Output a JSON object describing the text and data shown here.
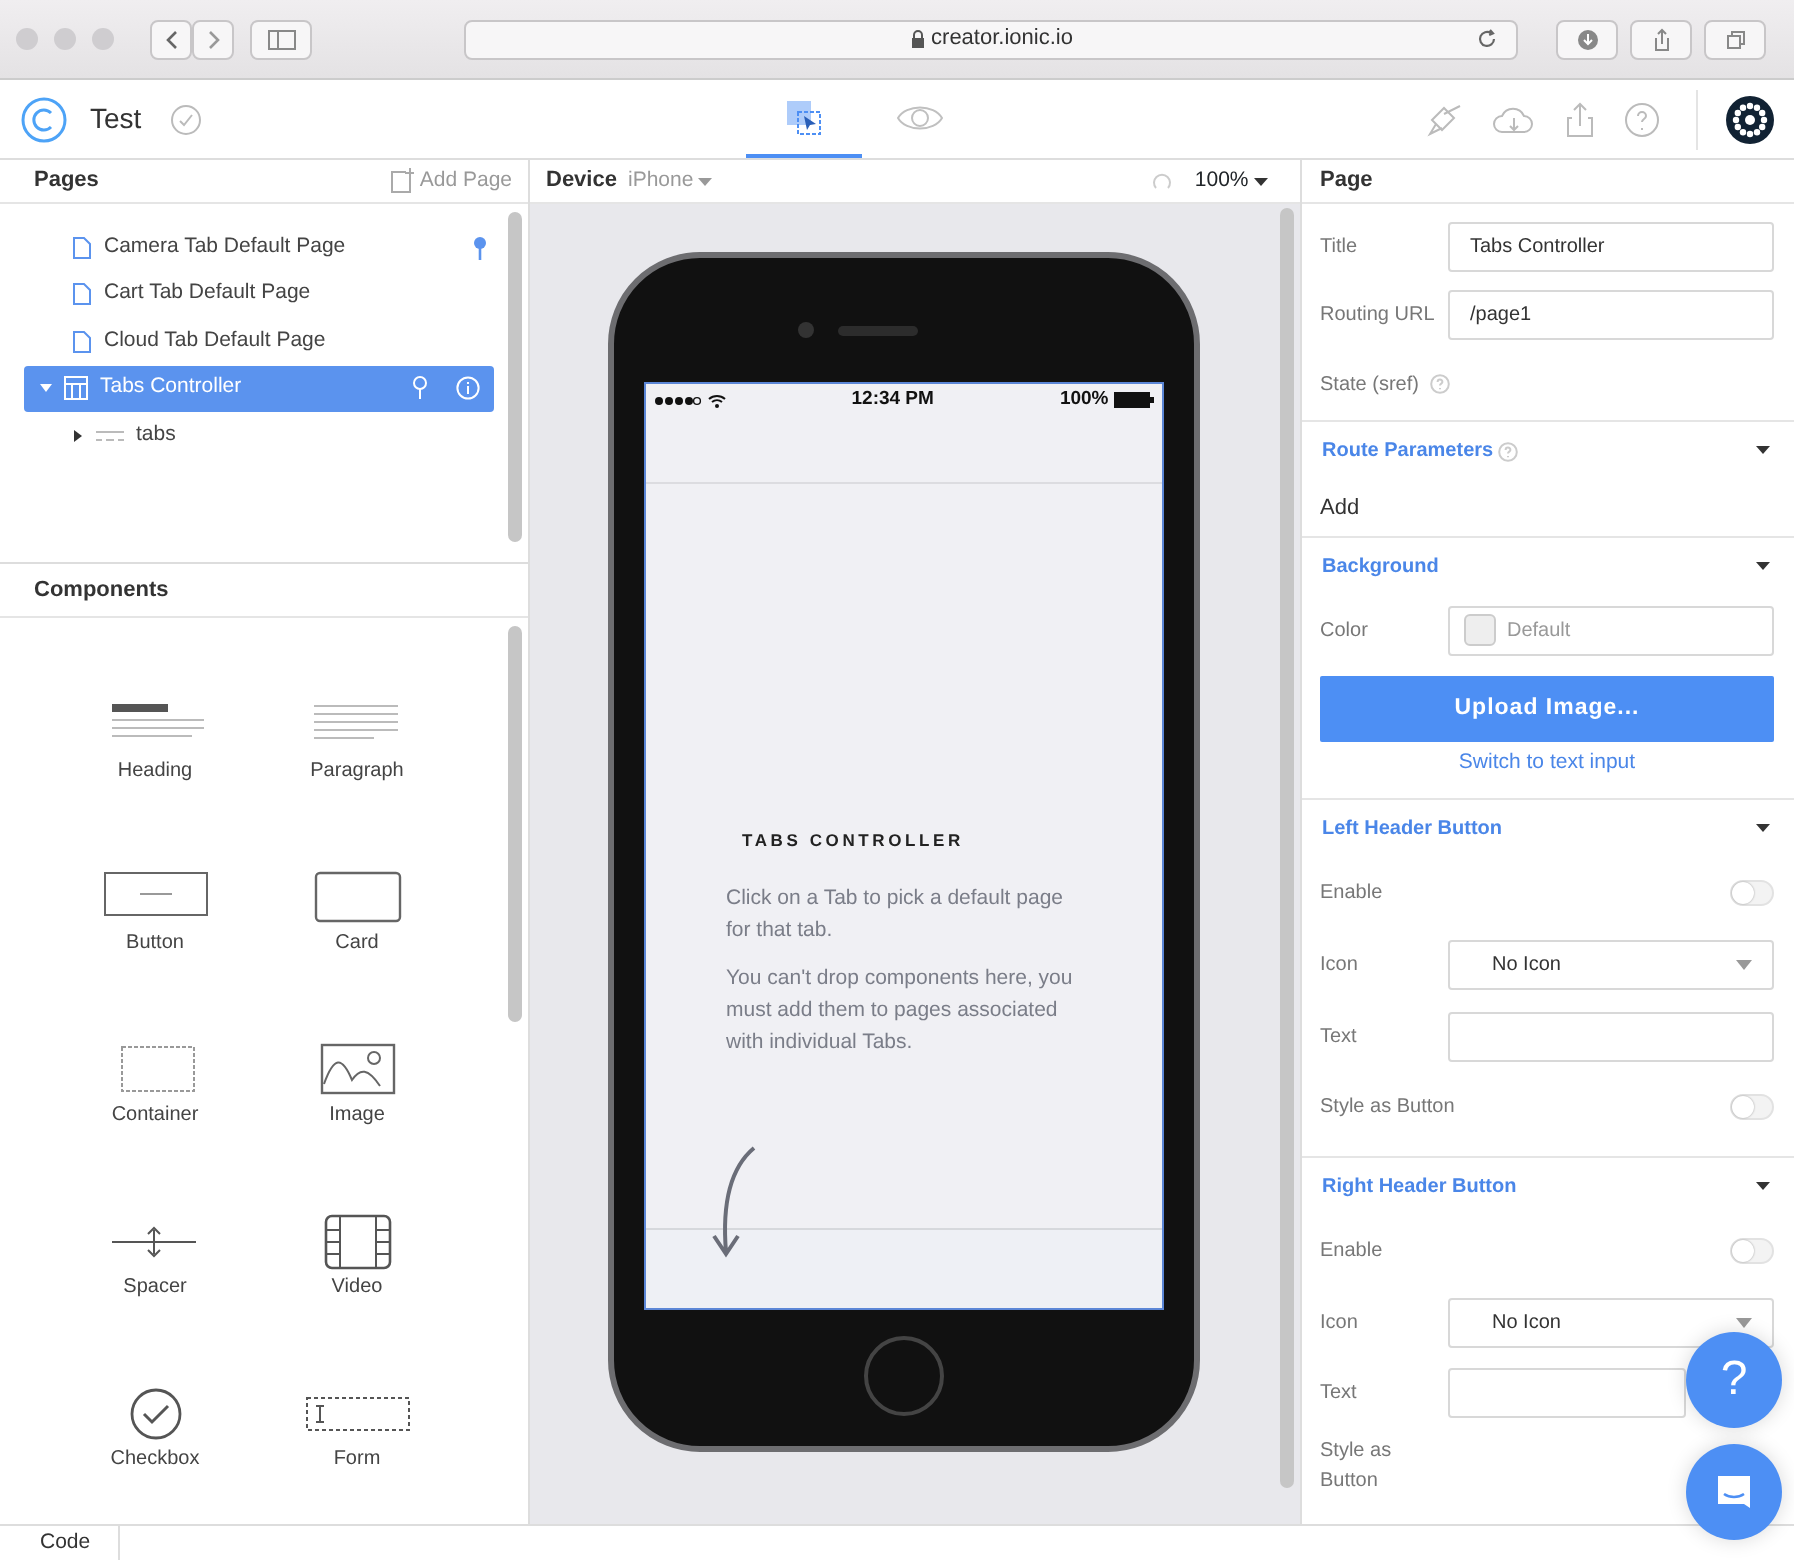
{
  "browser": {
    "url": "creator.ionic.io"
  },
  "app": {
    "project": "Test",
    "views": [
      {
        "kind": "design",
        "selected": true
      },
      {
        "kind": "preview",
        "selected": false
      }
    ]
  },
  "pages": {
    "title": "Pages",
    "add_label": "Add Page",
    "items": [
      {
        "label": "Camera Tab Default Page",
        "kind": "page",
        "selected": false,
        "pinned": true
      },
      {
        "label": "Cart Tab Default Page",
        "kind": "page",
        "selected": false,
        "pinned": false
      },
      {
        "label": "Cloud Tab Default Page",
        "kind": "page",
        "selected": false,
        "pinned": false
      },
      {
        "label": "Tabs Controller",
        "kind": "tabs",
        "selected": true,
        "pinned": false,
        "expanded": true,
        "children": [
          {
            "label": "tabs",
            "kind": "tabbar",
            "selected": false,
            "pinned": false,
            "expanded": false
          }
        ]
      }
    ]
  },
  "components": {
    "title": "Components",
    "items": [
      {
        "label": "Heading",
        "kind": "heading"
      },
      {
        "label": "Paragraph",
        "kind": "paragraph"
      },
      {
        "label": "Button",
        "kind": "button"
      },
      {
        "label": "Card",
        "kind": "card"
      },
      {
        "label": "Container",
        "kind": "container"
      },
      {
        "label": "Image",
        "kind": "image"
      },
      {
        "label": "Spacer",
        "kind": "spacer"
      },
      {
        "label": "Video",
        "kind": "video"
      },
      {
        "label": "Checkbox",
        "kind": "checkbox"
      },
      {
        "label": "Form",
        "kind": "form"
      }
    ]
  },
  "device": {
    "label": "Device",
    "value": "iPhone",
    "zoom": "100%"
  },
  "phone": {
    "time": "12:34 PM",
    "battery": "100%",
    "heading": "TABS CONTROLLER",
    "paragraphs": [
      "Click on a Tab to pick a default page for that tab.",
      "You can't drop components here, you must add them to pages associated with individual Tabs."
    ]
  },
  "properties": {
    "title": "Page",
    "fields": [
      {
        "kind": "text",
        "label": "Title",
        "value": "Tabs Controller"
      },
      {
        "kind": "text",
        "label": "Routing URL",
        "value": "/page1"
      },
      {
        "kind": "static",
        "label": "State (sref)",
        "help": true
      }
    ],
    "sections": [
      {
        "title": "Route Parameters",
        "help": true,
        "expanded": true,
        "rows": [
          {
            "kind": "action",
            "label": "Add"
          }
        ]
      },
      {
        "title": "Background",
        "help": false,
        "expanded": true,
        "rows": [
          {
            "kind": "color",
            "label": "Color",
            "placeholder": "Default"
          },
          {
            "kind": "button",
            "label": "Upload Image..."
          },
          {
            "kind": "link",
            "label": "Switch to text input"
          }
        ]
      },
      {
        "title": "Left Header Button",
        "help": false,
        "expanded": true,
        "rows": [
          {
            "kind": "toggle",
            "label": "Enable",
            "on": false
          },
          {
            "kind": "select",
            "label": "Icon",
            "value": "No Icon"
          },
          {
            "kind": "text",
            "label": "Text"
          },
          {
            "kind": "toggle",
            "label": "Style as Button",
            "on": false
          }
        ]
      },
      {
        "title": "Right Header Button",
        "help": false,
        "expanded": true,
        "rows": [
          {
            "kind": "toggle",
            "label": "Enable",
            "on": false
          },
          {
            "kind": "select",
            "label": "Icon",
            "value": "No Icon"
          },
          {
            "kind": "text",
            "label": "Text"
          },
          {
            "kind": "toggle",
            "label": "Style as Button"
          }
        ]
      }
    ]
  },
  "help_button": "?",
  "bottom_bar": {
    "tab": "Code"
  }
}
